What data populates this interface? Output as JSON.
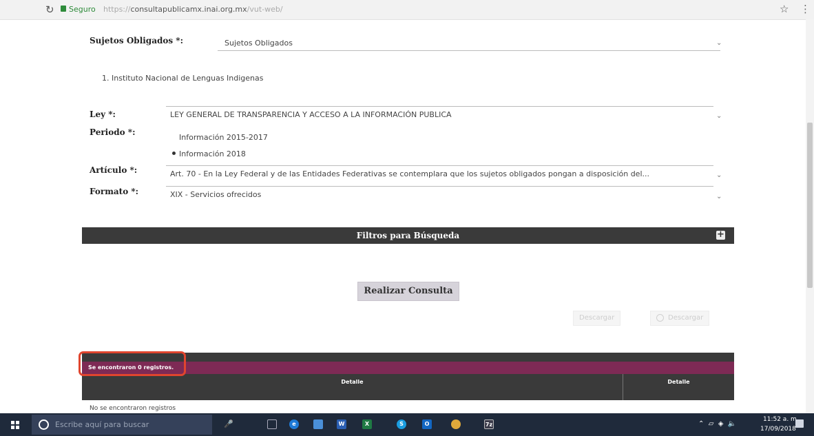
{
  "browser": {
    "secure_label": "Seguro",
    "url_proto": "https://",
    "url_host": "consultapublicamx.inai.org.mx",
    "url_path": "/vut-web/"
  },
  "form": {
    "sujetos_label": "Sujetos Obligados *:",
    "sujetos_value": "Sujetos Obligados",
    "selected_institution": "1. Instituto Nacional de Lenguas Indigenas",
    "ley_label": "Ley *:",
    "ley_value": "LEY GENERAL DE TRANSPARENCIA Y ACCESO A LA INFORMACIÓN PUBLICA",
    "periodo_label": "Periodo *:",
    "periodo_options": [
      "Información 2015-2017",
      "Información 2018"
    ],
    "periodo_selected": "Información 2018",
    "articulo_label": "Artículo *:",
    "articulo_value": "Art. 70 - En la Ley Federal y de las Entidades Federativas se contemplara que los sujetos obligados pongan a disposición del...",
    "formato_label": "Formato *:",
    "formato_value": "XIX - Servicios ofrecidos"
  },
  "filters": {
    "label": "Filtros para Búsqueda"
  },
  "actions": {
    "consult_label": "Realizar Consulta",
    "download_1": "Descargar",
    "download_2": "Descargar"
  },
  "results": {
    "count_text": "Se encontraron 0 registros.",
    "columns": [
      "Detalle",
      "Detalle"
    ],
    "empty_text": "No se encontraron registros"
  },
  "taskbar": {
    "search_placeholder": "Escribe aquí para buscar",
    "time": "11:52 a. m.",
    "date": "17/09/2018"
  },
  "icons": {
    "reload": "reload-icon",
    "lock": "lock-icon",
    "star": "star-icon",
    "menu": "menu-dots-icon",
    "expand": "plus-icon",
    "windows": "windows-logo-icon",
    "cortana": "cortana-icon"
  },
  "colors": {
    "filter_bar": "#3a3a3a",
    "result_bar": "#7e2a55",
    "highlight": "#e0452e",
    "consult_button": "#d6d3da",
    "taskbar": "#1f2a3b"
  }
}
